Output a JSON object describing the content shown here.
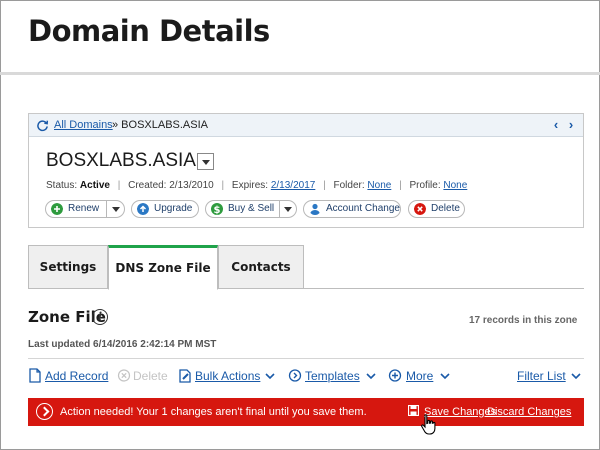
{
  "page": {
    "title": "Domain Details"
  },
  "card": {
    "breadcrumb_link": "All Domains",
    "breadcrumb_rest": "» BOSXLABS.ASIA",
    "prev_label": "‹",
    "next_label": "›",
    "domain_name": "BOSXLABS.ASIA",
    "status_label": "Status:",
    "status_value": "Active",
    "created_label": "Created:",
    "created_value": "2/13/2010",
    "expires_label": "Expires:",
    "expires_value": "2/13/2017",
    "folder_label": "Folder:",
    "folder_value": "None",
    "profile_label": "Profile:",
    "profile_value": "None",
    "buttons": {
      "renew": "Renew",
      "upgrade": "Upgrade",
      "buy_sell": "Buy & Sell",
      "account_change": "Account Change",
      "delete": "Delete"
    }
  },
  "tabs": [
    {
      "label": "Settings",
      "active": false
    },
    {
      "label": "DNS Zone File",
      "active": true
    },
    {
      "label": "Contacts",
      "active": false
    }
  ],
  "zone": {
    "title": "Zone File",
    "info_glyph": "i",
    "records": "17 records in this zone",
    "last_updated": "Last updated 6/14/2016 2:42:14 PM MST"
  },
  "actions": {
    "add_record": "Add Record",
    "delete": "Delete",
    "bulk_actions": "Bulk Actions",
    "templates": "Templates",
    "more": "More",
    "filter_list": "Filter List"
  },
  "banner": {
    "message": "Action needed! Your 1 changes aren't final until you save them.",
    "save": "Save Changes",
    "discard": "Discard Changes"
  },
  "colors": {
    "accent_link": "#1a5aa8",
    "active_tab": "#1fa34a",
    "banner": "#d6170f"
  }
}
